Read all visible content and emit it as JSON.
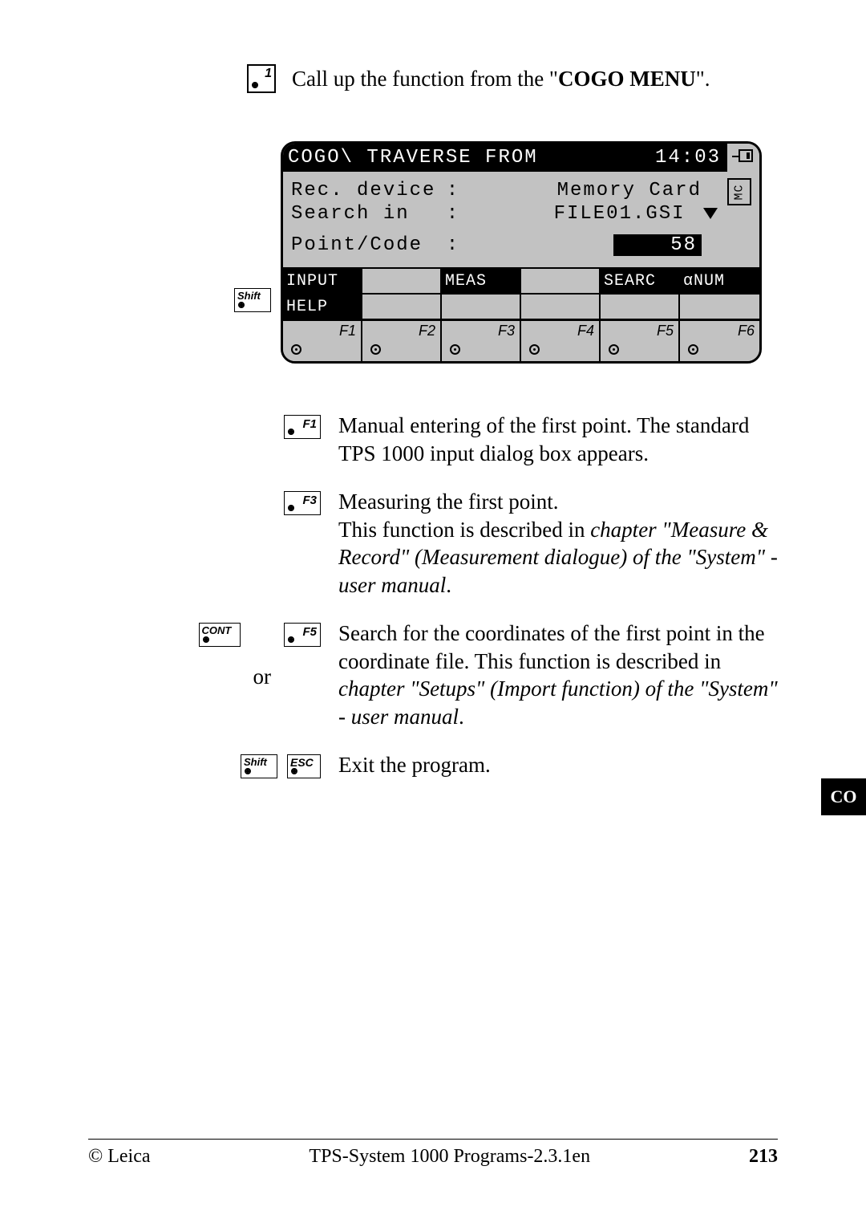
{
  "step": {
    "number": "1",
    "text_pre": "Call up the function from the \"",
    "text_bold": "COGO MENU",
    "text_post": "\"."
  },
  "lcd": {
    "title": "COGO\\ TRAVERSE FROM",
    "time": "14:03",
    "mc_label": "MC",
    "rows": {
      "rec_device": {
        "label": "Rec. device",
        "value": "Memory Card"
      },
      "search_in": {
        "label": "Search in",
        "value": "FILE01.GSI"
      },
      "point_code": {
        "label": "Point/Code",
        "value": "58"
      }
    },
    "softkeys_row1": [
      "INPUT",
      "",
      "MEAS",
      "",
      "SEARC",
      "αNUM"
    ],
    "softkeys_row2": [
      "HELP",
      "",
      "",
      "",
      "",
      ""
    ],
    "fkeys": [
      "F1",
      "F2",
      "F3",
      "F4",
      "F5",
      "F6"
    ]
  },
  "shift_label": "Shift",
  "desc": {
    "f1": {
      "key": "F1",
      "text": "Manual entering of the first point. The standard TPS 1000 input dialog box appears."
    },
    "f3": {
      "key": "F3",
      "line1": "Measuring the first point.",
      "line2a": "This function is described in ",
      "line2b": "chapter \"Measure & Record\" (Measurement dialogue) of  the \"System\" - user manual",
      "line2c": "."
    },
    "f5": {
      "cont": "CONT",
      "or": "or",
      "key": "F5",
      "line1a": "Search for the coordinates of the first point in the coordinate file. This function is described in ",
      "line1b": "chapter \"Setups\" (Import function) of the \"System\" - user manual",
      "line1c": "."
    },
    "exit": {
      "shift": "Shift",
      "esc": "ESC",
      "text": "Exit the program."
    }
  },
  "side_tab": "CO",
  "footer": {
    "left": "© Leica",
    "center": "TPS-System 1000 Programs-2.3.1en",
    "right": "213"
  }
}
